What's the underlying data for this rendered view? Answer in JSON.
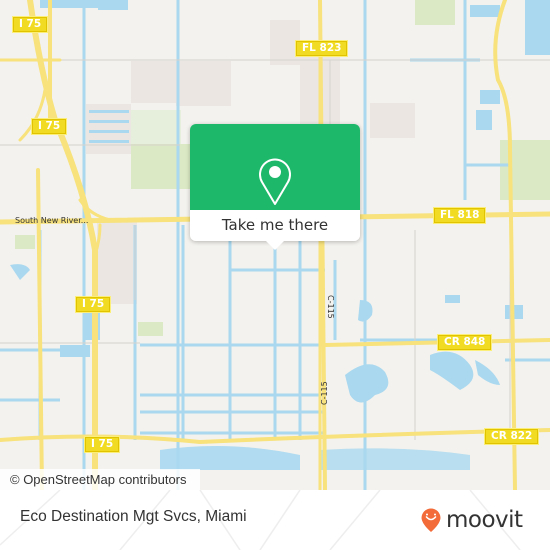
{
  "map": {
    "road_shields": [
      {
        "label": "I 75"
      },
      {
        "label": "I 75"
      },
      {
        "label": "I 75"
      },
      {
        "label": "I 75"
      },
      {
        "label": "I 75"
      },
      {
        "label": "FL 823"
      },
      {
        "label": "FL 818"
      },
      {
        "label": "CR 848"
      },
      {
        "label": "CR 822"
      }
    ],
    "road_labels": [
      {
        "label": "South New River..."
      },
      {
        "label": "C-115"
      },
      {
        "label": "C-115"
      }
    ],
    "attribution": "© OpenStreetMap contributors",
    "colors": {
      "land": "#f3f2ee",
      "water": "#a9d8ef",
      "road": "#f7e27c",
      "park": "#dbe9c4",
      "urban": "#ebe6e2"
    }
  },
  "popup": {
    "button_label": "Take me there",
    "icon": "map-pin-icon",
    "color": "#1eb86b"
  },
  "footer": {
    "place_name": "Eco Destination Mgt Svcs, Miami",
    "brand": "moovit",
    "brand_color": "#f26b38"
  }
}
